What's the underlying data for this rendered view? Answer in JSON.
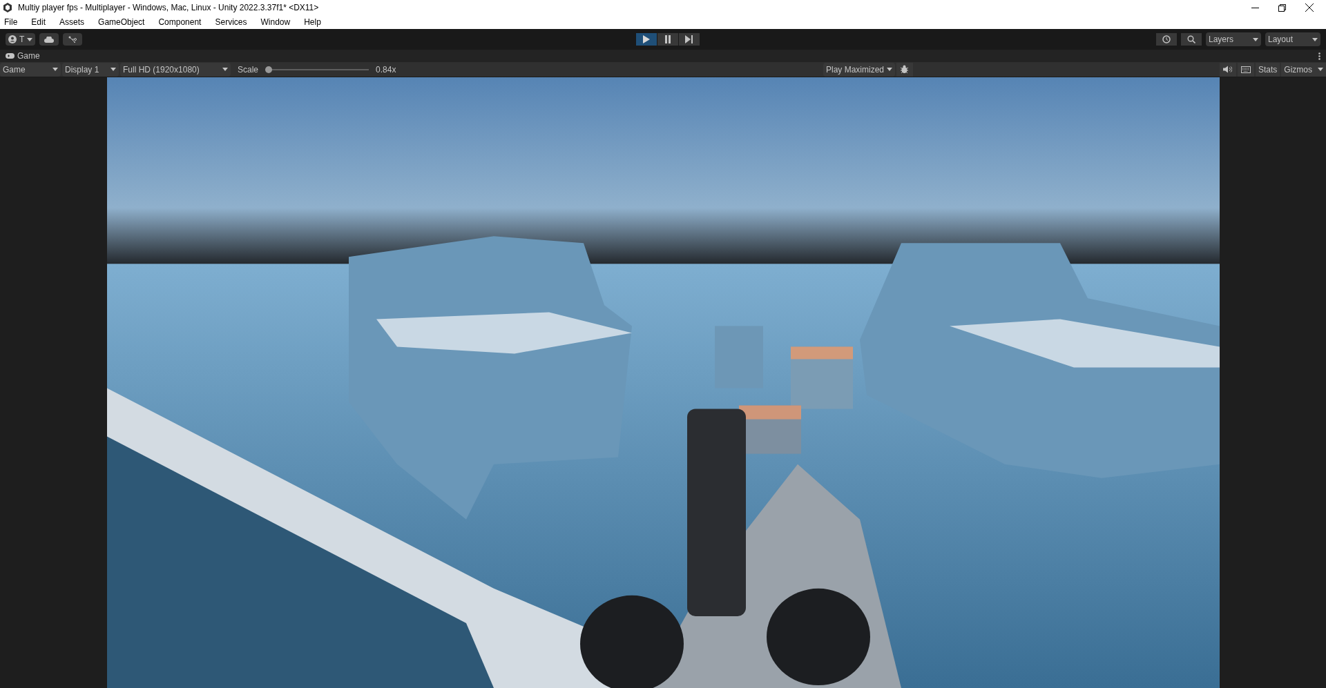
{
  "window": {
    "title": "Multiy player fps - Multiplayer - Windows, Mac, Linux - Unity 2022.3.37f1* <DX11>"
  },
  "menu": [
    "File",
    "Edit",
    "Assets",
    "GameObject",
    "Component",
    "Services",
    "Window",
    "Help"
  ],
  "toolbar": {
    "account": "T",
    "play_controls": [
      {
        "kind": "play",
        "selected": true
      },
      {
        "kind": "pause",
        "selected": false
      },
      {
        "kind": "step",
        "selected": false
      }
    ],
    "layers": "Layers",
    "layout": "Layout"
  },
  "tab": {
    "label": "Game"
  },
  "game_bar": {
    "view": "Game",
    "display": "Display 1",
    "resolution": "Full HD (1920x1080)",
    "scale": {
      "label": "Scale",
      "level": 0.0,
      "reading": "0.84x"
    },
    "play_mode": "Play Maximized",
    "stats": "Stats",
    "gizmos": "Gizmos"
  }
}
